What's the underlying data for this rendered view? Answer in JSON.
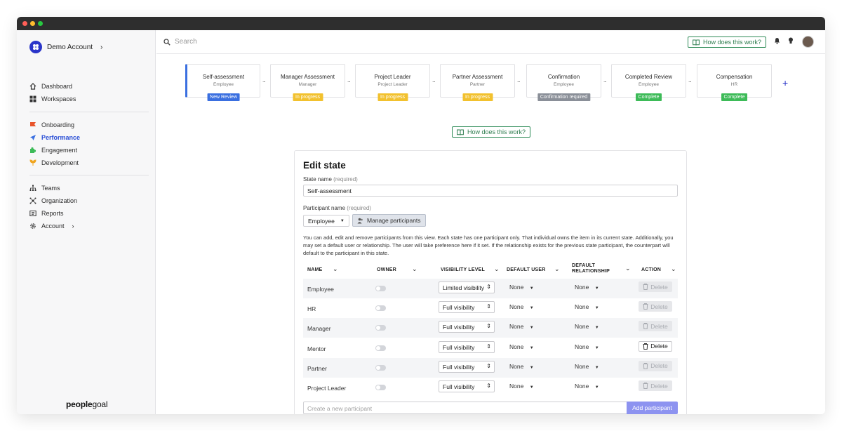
{
  "window": {
    "dot_colors": [
      "#ff5f57",
      "#febc2e",
      "#28c840"
    ]
  },
  "sidebar": {
    "account": {
      "label": "Demo Account",
      "chevron": "›"
    },
    "groups": [
      [
        {
          "label": "Dashboard",
          "icon": "home-icon"
        },
        {
          "label": "Workspaces",
          "icon": "grid-icon"
        }
      ],
      [
        {
          "label": "Onboarding",
          "icon": "flag-icon"
        },
        {
          "label": "Performance",
          "icon": "paper-plane-icon",
          "active": true
        },
        {
          "label": "Engagement",
          "icon": "puzzle-icon"
        },
        {
          "label": "Development",
          "icon": "sprout-icon"
        }
      ],
      [
        {
          "label": "Teams",
          "icon": "org-tree-icon"
        },
        {
          "label": "Organization",
          "icon": "network-icon"
        },
        {
          "label": "Reports",
          "icon": "report-icon"
        },
        {
          "label": "Account",
          "icon": "gear-icon"
        }
      ]
    ],
    "account_item_chevron": "›",
    "brand_bold": "people",
    "brand_light": "goal"
  },
  "topbar": {
    "search_placeholder": "Search",
    "how_label": "How does this work?"
  },
  "stages": [
    {
      "name": "Self-assessment",
      "role": "Employee",
      "badge": "New Review",
      "badge_color": "#3a6fe0"
    },
    {
      "name": "Manager Assessment",
      "role": "Manager",
      "badge": "In progress",
      "badge_color": "#f2c12e"
    },
    {
      "name": "Project Leader",
      "role": "Project Leader",
      "badge": "In progress",
      "badge_color": "#f2c12e"
    },
    {
      "name": "Partner Assessment",
      "role": "Partner",
      "badge": "In progress",
      "badge_color": "#f2c12e"
    },
    {
      "name": "Confirmation",
      "role": "Employee",
      "badge": "Confirmation required",
      "badge_color": "#8a8f98"
    },
    {
      "name": "Completed Review",
      "role": "Employee",
      "badge": "Complete",
      "badge_color": "#3dbb58"
    },
    {
      "name": "Compensation",
      "role": "HR",
      "badge": "Complete",
      "badge_color": "#3dbb58"
    }
  ],
  "stage_separator": "...",
  "add_stage": "+",
  "how_label": "How does this work?",
  "edit": {
    "title": "Edit state",
    "state_label": "State name",
    "required": "(required)",
    "state_value": "Self-assessment",
    "participant_label": "Participant name",
    "participant_value": "Employee",
    "manage_label": "Manage participants",
    "description": "You can add, edit and remove participants from this view. Each state has one participant only. That individual owns the item in its current state. Additionally, you may set a default user or relationship. The user will take preference here if it set. If the relationship exists for the previous state participant, the counterpart will default to the participant in this state.",
    "columns": [
      "NAME",
      "OWNER",
      "VISIBILITY LEVEL",
      "DEFAULT USER",
      "DEFAULT RELATIONSHIP",
      "ACTION"
    ],
    "rows": [
      {
        "name": "Employee",
        "visibility": "Limited visibility",
        "user": "None",
        "relationship": "None",
        "action": "Delete",
        "enabled": false
      },
      {
        "name": "HR",
        "visibility": "Full visibility",
        "user": "None",
        "relationship": "None",
        "action": "Delete",
        "enabled": false
      },
      {
        "name": "Manager",
        "visibility": "Full visibility",
        "user": "None",
        "relationship": "None",
        "action": "Delete",
        "enabled": false
      },
      {
        "name": "Mentor",
        "visibility": "Full visibility",
        "user": "None",
        "relationship": "None",
        "action": "Delete",
        "enabled": true
      },
      {
        "name": "Partner",
        "visibility": "Full visibility",
        "user": "None",
        "relationship": "None",
        "action": "Delete",
        "enabled": false
      },
      {
        "name": "Project Leader",
        "visibility": "Full visibility",
        "user": "None",
        "relationship": "None",
        "action": "Delete",
        "enabled": false
      }
    ],
    "new_placeholder": "Create a new participant",
    "add_label": "Add participant"
  }
}
